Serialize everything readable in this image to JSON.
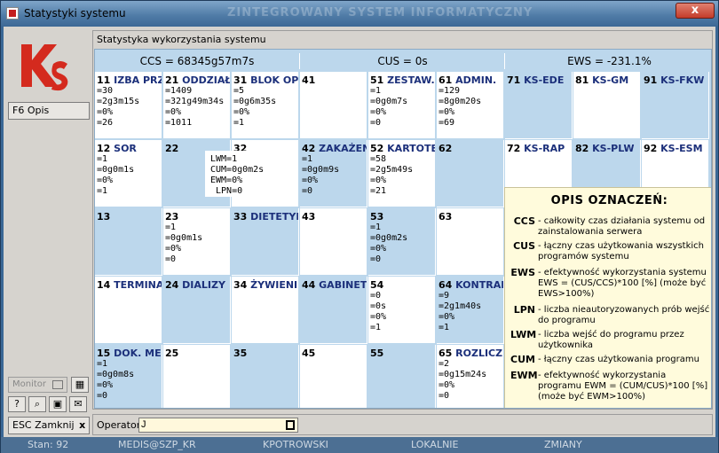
{
  "window": {
    "title": "Statystyki systemu",
    "bg_title": "ZINTEGROWANY SYSTEM INFORMATYCZNY",
    "close_label": "x"
  },
  "sidebar": {
    "f6_label": "F6 Opis",
    "monitor_label": "Monitor",
    "esc_label": "ESC Zamknij",
    "esc_icon": "x",
    "tools": [
      "?",
      "🔍",
      "📷",
      "✉"
    ]
  },
  "panel": {
    "title": "Statystyka wykorzystania systemu",
    "headers": {
      "ccs": "CCS = 68345g57m7s",
      "cus": "CUS = 0s",
      "ews": "EWS = -231.1%"
    }
  },
  "tooltip": [
    "LWM=1",
    "CUM=0g0m2s",
    "EWM=0%",
    " LPN=0"
  ],
  "cells": [
    {
      "name": "IZBA PRZ",
      "num": "11",
      "color": "white",
      "stats": [
        "=30",
        "=2g3m15s",
        "=0%",
        "=26"
      ]
    },
    {
      "name": "ODDZIAŁ",
      "num": "21",
      "color": "white",
      "stats": [
        "=1409",
        "=321g49m34s",
        "=0%",
        "=1011"
      ]
    },
    {
      "name": "BLOK OPE",
      "num": "31",
      "color": "white",
      "stats": [
        "=5",
        "=0g6m35s",
        "=0%",
        "=1"
      ]
    },
    {
      "name": "",
      "num": "41",
      "color": "white",
      "stats": []
    },
    {
      "name": "ZESTAW.",
      "num": "51",
      "color": "white",
      "stats": [
        "=1",
        "=0g0m7s",
        "=0%",
        "=0"
      ]
    },
    {
      "name": "ADMIN.",
      "num": "61",
      "color": "white",
      "stats": [
        "=129",
        "=8g0m20s",
        "=0%",
        "=69"
      ]
    },
    {
      "name": "KS-EDE",
      "num": "71",
      "color": "blue",
      "stats": []
    },
    {
      "name": "KS-GM",
      "num": "81",
      "color": "white",
      "stats": []
    },
    {
      "name": "KS-FKW",
      "num": "91",
      "color": "blue",
      "stats": []
    },
    {
      "name": "SOR",
      "num": "12",
      "color": "white",
      "stats": [
        "=1",
        "=0g0m1s",
        "=0%",
        "=1"
      ]
    },
    {
      "name": "",
      "num": "22",
      "color": "blue",
      "stats": []
    },
    {
      "name": "",
      "num": "32",
      "color": "white",
      "stats": []
    },
    {
      "name": "ZAKAŻEN",
      "num": "42",
      "color": "blue",
      "stats": [
        "=1",
        "=0g0m9s",
        "=0%",
        "=0"
      ]
    },
    {
      "name": "KARTOTE",
      "num": "52",
      "color": "white",
      "stats": [
        "=58",
        "=2g5m49s",
        "=0%",
        "=21"
      ]
    },
    {
      "name": "",
      "num": "62",
      "color": "blue",
      "stats": []
    },
    {
      "name": "KS-RAP",
      "num": "72",
      "color": "white",
      "stats": []
    },
    {
      "name": "KS-PLW",
      "num": "82",
      "color": "blue",
      "stats": []
    },
    {
      "name": "KS-ESM",
      "num": "92",
      "color": "white",
      "stats": []
    },
    {
      "name": "",
      "num": "13",
      "color": "blue",
      "stats": []
    },
    {
      "name": "",
      "num": "23",
      "color": "white",
      "stats": [
        "=1",
        "=0g0m1s",
        "=0%",
        "=0"
      ]
    },
    {
      "name": "DIETETYK",
      "num": "33",
      "color": "blue",
      "stats": []
    },
    {
      "name": "",
      "num": "43",
      "color": "white",
      "stats": []
    },
    {
      "name": "",
      "num": "53",
      "color": "blue",
      "stats": [
        "=1",
        "=0g0m2s",
        "=0%",
        "=0"
      ]
    },
    {
      "name": "",
      "num": "63",
      "color": "white",
      "stats": []
    },
    {
      "name": "",
      "num": "",
      "color": "blue",
      "stats": []
    },
    {
      "name": "",
      "num": "",
      "color": "white",
      "stats": []
    },
    {
      "name": "",
      "num": "",
      "color": "blue",
      "stats": []
    },
    {
      "name": "TERMINA",
      "num": "14",
      "color": "white",
      "stats": []
    },
    {
      "name": "DIALIZY",
      "num": "24",
      "color": "blue",
      "stats": []
    },
    {
      "name": "ŻYWIENIE",
      "num": "34",
      "color": "white",
      "stats": []
    },
    {
      "name": "GABINET",
      "num": "44",
      "color": "blue",
      "stats": []
    },
    {
      "name": "",
      "num": "54",
      "color": "white",
      "stats": [
        "=0",
        "=0s",
        "=0%",
        "=1"
      ]
    },
    {
      "name": "KONTRAH",
      "num": "64",
      "color": "blue",
      "stats": [
        "=9",
        "=2g1m40s",
        "=0%",
        "=1"
      ]
    },
    {
      "name": "",
      "num": "",
      "color": "white",
      "stats": []
    },
    {
      "name": "",
      "num": "",
      "color": "blue",
      "stats": []
    },
    {
      "name": "",
      "num": "",
      "color": "white",
      "stats": []
    },
    {
      "name": "DOK. MED",
      "num": "15",
      "color": "blue",
      "stats": [
        "=1",
        "=0g0m8s",
        "=0%",
        "=0"
      ]
    },
    {
      "name": "",
      "num": "25",
      "color": "white",
      "stats": []
    },
    {
      "name": "",
      "num": "35",
      "color": "blue",
      "stats": []
    },
    {
      "name": "",
      "num": "45",
      "color": "white",
      "stats": []
    },
    {
      "name": "",
      "num": "55",
      "color": "blue",
      "stats": []
    },
    {
      "name": "ROZLICZ",
      "num": "65",
      "color": "white",
      "stats": [
        "=2",
        "=0g15m24s",
        "=0%",
        "=0"
      ]
    },
    {
      "name": "",
      "num": "",
      "color": "blue",
      "stats": []
    },
    {
      "name": "",
      "num": "",
      "color": "white",
      "stats": []
    },
    {
      "name": "",
      "num": "",
      "color": "blue",
      "stats": []
    }
  ],
  "legend": {
    "title": "OPIS OZNACZEŃ:",
    "rows": [
      {
        "abbr": "CCS",
        "desc": "- całkowity czas działania systemu od zainstalowania serwera"
      },
      {
        "abbr": "CUS",
        "desc": "- łączny czas użytkowania wszystkich programów systemu"
      },
      {
        "abbr": "EWS",
        "desc": "- efektywność wykorzystania systemu EWS = (CUS/CCS)*100 [%] (może być EWS>100%)"
      },
      {
        "abbr": "LPN",
        "desc": "- liczba nieautoryzowanych prób wejść do programu"
      },
      {
        "abbr": "LWM",
        "desc": "- liczba wejść do programu przez użytkownika"
      },
      {
        "abbr": "CUM",
        "desc": "- łączny czas użytkowania programu"
      },
      {
        "abbr": "EWM",
        "desc": "- efektywność wykorzystania programu EWM = (CUM/CUS)*100 [%] (może być EWM>100%)"
      }
    ]
  },
  "operator": {
    "label": "Operator:",
    "value": "J"
  },
  "statusbar": [
    "Stan: 92",
    "MEDIS@SZP_KR",
    "KPOTROWSKI",
    "LOKALNIE",
    "ZMIANY"
  ],
  "colors": {
    "cell_blue": "#bcd7ec",
    "name_blue": "#1b2f7a",
    "legend_bg": "#fffbdc",
    "logo_red": "#d42a1e"
  }
}
